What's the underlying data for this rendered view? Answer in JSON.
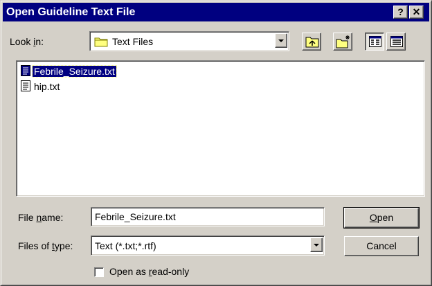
{
  "window": {
    "title": "Open Guideline Text File",
    "help_glyph": "?",
    "close_glyph": "✕"
  },
  "look_in": {
    "label_pre": "Look ",
    "label_key": "i",
    "label_post": "n:",
    "value": "Text Files",
    "icon": "folder-icon"
  },
  "toolbar": {
    "icons": [
      "up-one-level-icon",
      "create-new-folder-icon",
      "list-view-icon",
      "details-view-icon"
    ]
  },
  "files": [
    {
      "name": "Febrile_Seizure.txt",
      "icon": "text-file-icon",
      "selected": true
    },
    {
      "name": "hip.txt",
      "icon": "text-file-icon",
      "selected": false
    }
  ],
  "file_name": {
    "label_pre": "File ",
    "label_key": "n",
    "label_post": "ame:",
    "value": "Febrile_Seizure.txt"
  },
  "file_type": {
    "label_pre": "Files of ",
    "label_key": "t",
    "label_post": "ype:",
    "value": "Text (*.txt;*.rtf)"
  },
  "buttons": {
    "open_key": "O",
    "open_rest": "pen",
    "cancel": "Cancel"
  },
  "readonly": {
    "label_pre": "Open as ",
    "label_key": "r",
    "label_post": "ead-only",
    "checked": false
  },
  "colors": {
    "title_bar": "#000080",
    "dialog_face": "#d4d0c8",
    "selection": "#000080"
  }
}
